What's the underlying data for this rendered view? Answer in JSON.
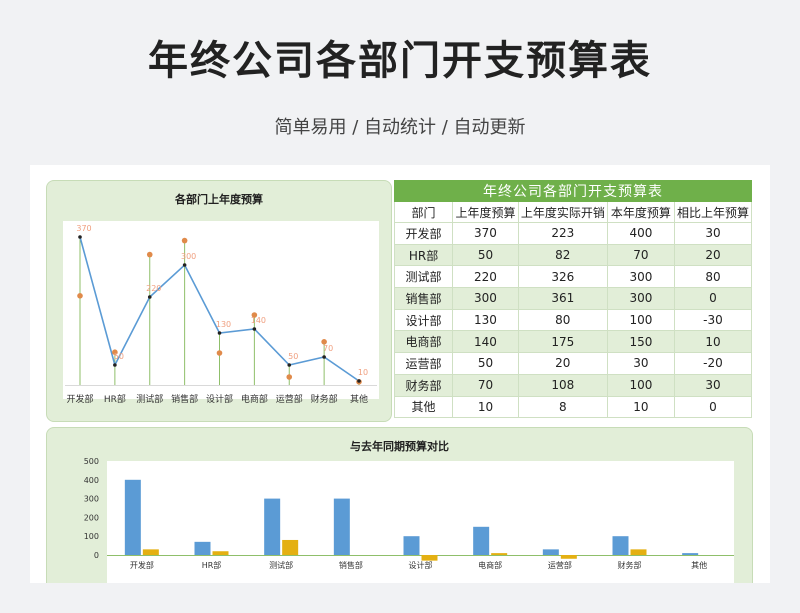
{
  "header": {
    "title": "年终公司各部门开支预算表",
    "subtitle": "简单易用  /  自动统计  /  自动更新"
  },
  "table": {
    "banner": "年终公司各部门开支预算表",
    "columns": [
      "部门",
      "上年度预算",
      "上年度实际开销",
      "本年度预算",
      "相比上年预算"
    ],
    "rows": [
      [
        "开发部",
        "370",
        "223",
        "400",
        "30"
      ],
      [
        "HR部",
        "50",
        "82",
        "70",
        "20"
      ],
      [
        "测试部",
        "220",
        "326",
        "300",
        "80"
      ],
      [
        "销售部",
        "300",
        "361",
        "300",
        "0"
      ],
      [
        "设计部",
        "130",
        "80",
        "100",
        "-30"
      ],
      [
        "电商部",
        "140",
        "175",
        "150",
        "10"
      ],
      [
        "运营部",
        "50",
        "20",
        "30",
        "-20"
      ],
      [
        "财务部",
        "70",
        "108",
        "100",
        "30"
      ],
      [
        "其他",
        "10",
        "8",
        "10",
        "0"
      ]
    ]
  },
  "chart_data": [
    {
      "type": "line",
      "title": "各部门上年度预算",
      "categories": [
        "开发部",
        "HR部",
        "测试部",
        "销售部",
        "设计部",
        "电商部",
        "运营部",
        "财务部",
        "其他"
      ],
      "series": [
        {
          "values": [
            370,
            50,
            220,
            300,
            130,
            140,
            50,
            70,
            10
          ],
          "color": "#5b9bd5"
        }
      ],
      "secondary_points": [
        223,
        82,
        326,
        361,
        80,
        175,
        20,
        108,
        8
      ],
      "data_labels": [
        "370",
        "50",
        "220",
        "300",
        "130",
        "140",
        "50",
        "70",
        "10"
      ],
      "ylim": [
        0,
        400
      ],
      "colors": {
        "line": "#5b9bd5",
        "points": "#e08a4a",
        "drop_lines": "#8fbf6a"
      }
    },
    {
      "type": "bar",
      "title": "与去年同期预算对比",
      "categories": [
        "开发部",
        "HR部",
        "测试部",
        "销售部",
        "设计部",
        "电商部",
        "运营部",
        "财务部",
        "其他"
      ],
      "series": [
        {
          "values": [
            400,
            70,
            300,
            300,
            100,
            150,
            30,
            100,
            10
          ],
          "color": "#5b9bd5"
        },
        {
          "values": [
            30,
            20,
            80,
            0,
            -30,
            10,
            -20,
            30,
            0
          ],
          "color": "#e4b012"
        }
      ],
      "yticks": [
        "500",
        "400",
        "300",
        "200",
        "100",
        "0"
      ],
      "ylim": [
        -60,
        500
      ]
    }
  ]
}
